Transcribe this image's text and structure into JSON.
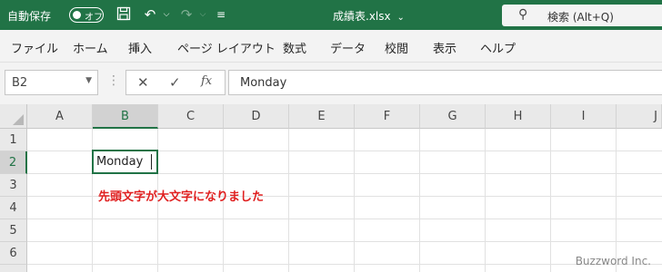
{
  "titlebar": {
    "autosave_label": "自動保存",
    "autosave_state": "オフ",
    "filename": "成績表.xlsx",
    "search_label": "検索 (Alt+Q)",
    "icons": [
      "save-icon",
      "undo-icon",
      "redo-icon",
      "customize-icon",
      "chevron-down-icon",
      "search-icon"
    ]
  },
  "menu": [
    "ファイル",
    "ホーム",
    "挿入",
    "ページ レイアウト",
    "数式",
    "データ",
    "校閲",
    "表示",
    "ヘルプ"
  ],
  "formula_bar": {
    "name_box": "B2",
    "fx_symbol": "fx",
    "content": "Monday"
  },
  "sheet": {
    "columns": [
      "A",
      "B",
      "C",
      "D",
      "E",
      "F",
      "G",
      "H",
      "I",
      "J"
    ],
    "rows": [
      "1",
      "2",
      "3",
      "4",
      "5",
      "6"
    ],
    "selected_column": "B",
    "selected_row": "2",
    "active_cell_value": "Monday"
  },
  "annotation": "先頭文字が大文字になりました",
  "watermark": "Buzzword Inc.",
  "colors": {
    "accent": "#217346",
    "annotation": "#e02020"
  }
}
